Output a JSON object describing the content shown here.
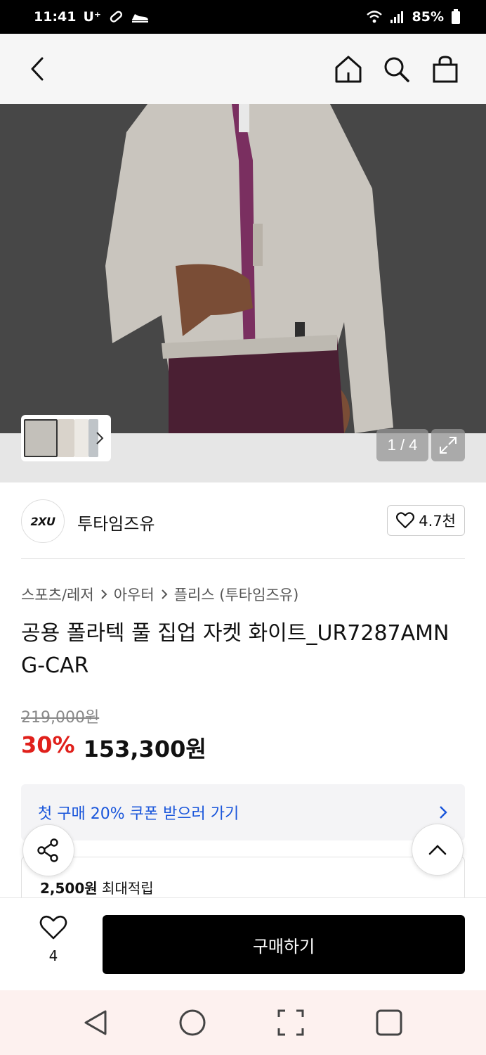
{
  "status": {
    "time": "11:41",
    "carrier": "U⁺",
    "battery": "85%"
  },
  "header": {
    "back_icon": "chevron-left-icon",
    "home_icon": "home-icon",
    "search_icon": "search-icon",
    "bag_icon": "shopping-bag-icon"
  },
  "gallery": {
    "counter": "1 / 4"
  },
  "brand": {
    "logo_text": "2XU",
    "name": "투타임즈유",
    "likes": "4.7천"
  },
  "breadcrumb": [
    "스포츠/레저",
    "아우터",
    "플리스 (투타임즈유)"
  ],
  "product": {
    "title": "공용 폴라텍 풀 집업 자켓 화이트_UR7287AMNG-CAR",
    "original_price": "219,000원",
    "discount": "30%",
    "sale_price": "153,300원"
  },
  "coupon": {
    "text": "첫 구매 20% 쿠폰 받으러 가기"
  },
  "points": {
    "amount": "2,500원",
    "label": "최대적립"
  },
  "bottom": {
    "like_count": "4",
    "buy_label": "구매하기"
  },
  "colors": {
    "accent_red": "#e0201b",
    "link_blue": "#1a56db",
    "buy_button": "#000000"
  }
}
